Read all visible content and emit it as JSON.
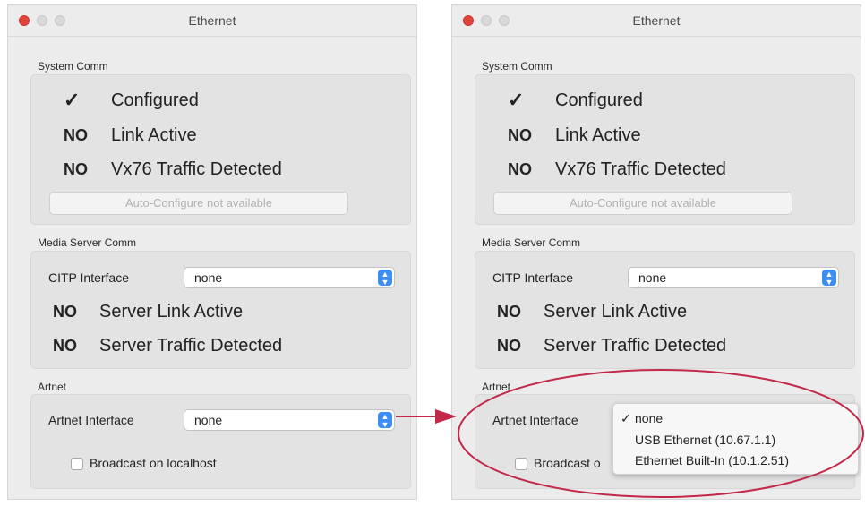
{
  "window_title": "Ethernet",
  "system_comm": {
    "section_label": "System Comm",
    "configured_flag": "✓",
    "configured_label": "Configured",
    "link_flag": "NO",
    "link_label": "Link Active",
    "traffic_flag": "NO",
    "traffic_label": "Vx76 Traffic Detected",
    "auto_configure_label": "Auto-Configure not available"
  },
  "media_server_comm": {
    "section_label": "Media Server Comm",
    "citp_label": "CITP Interface",
    "citp_value": "none",
    "server_link_flag": "NO",
    "server_link_label": "Server Link Active",
    "server_traffic_flag": "NO",
    "server_traffic_label": "Server Traffic Detected"
  },
  "artnet": {
    "section_label": "Artnet",
    "interface_label": "Artnet Interface",
    "interface_value": "none",
    "broadcast_label": "Broadcast on localhost",
    "broadcast_label_truncated": "Broadcast o",
    "broadcast_checked": false
  },
  "artnet_menu": {
    "selected_check": "✓",
    "options": [
      "none",
      "USB Ethernet (10.67.1.1)",
      "Ethernet Built-In (10.1.2.51)"
    ]
  },
  "colors": {
    "annotation": "#c2284a",
    "popup_accent": "#3c8ef4",
    "close_button": "#e0443e"
  }
}
